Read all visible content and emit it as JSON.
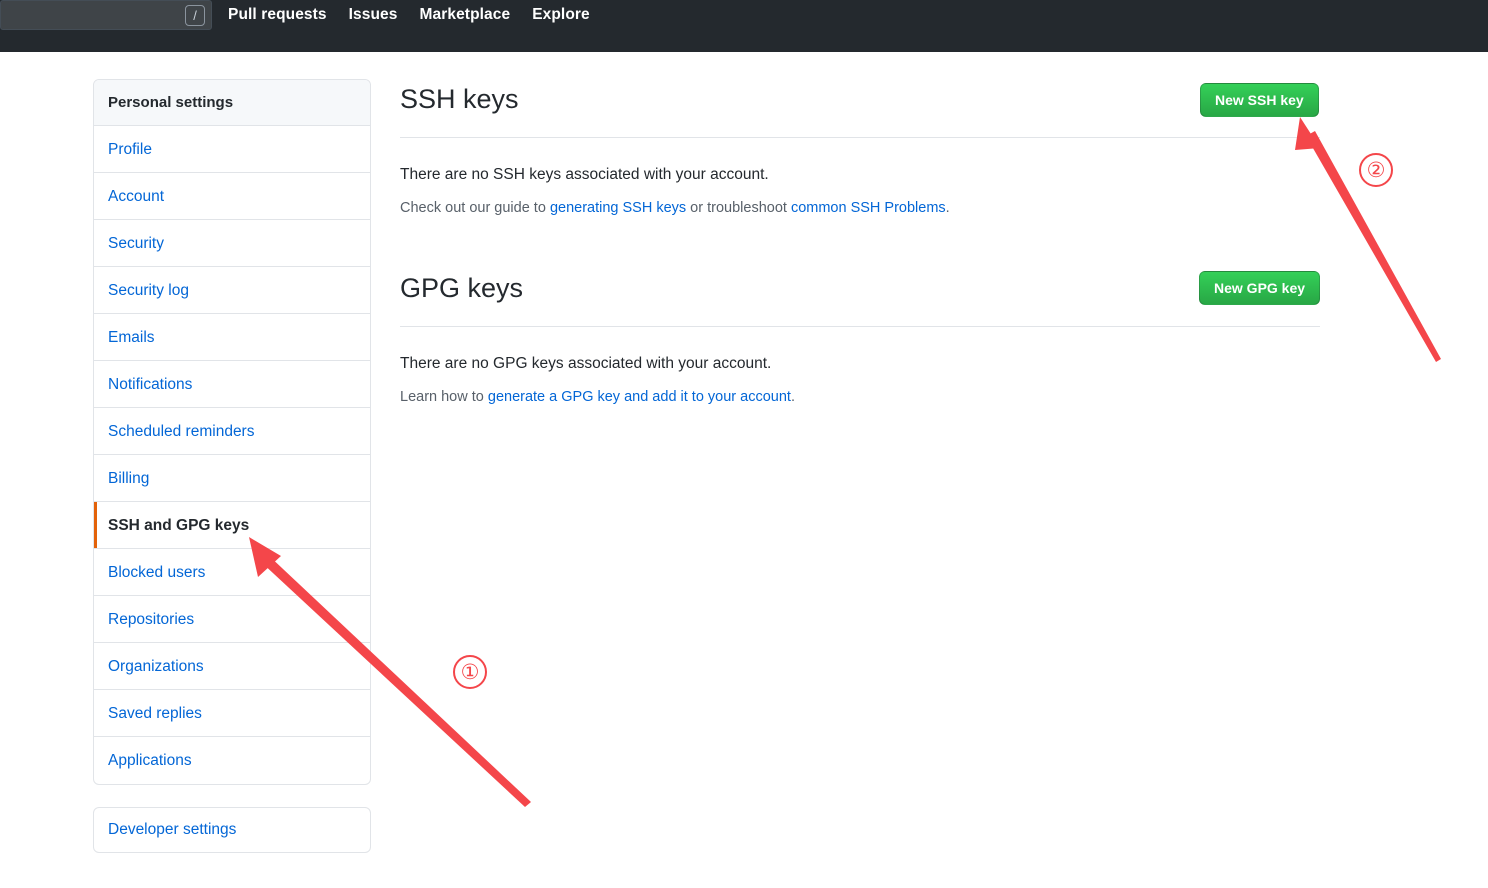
{
  "topbar": {
    "search": {
      "value": "",
      "placeholder": "",
      "shortcut": "/"
    },
    "nav_items": [
      {
        "label": "Pull requests"
      },
      {
        "label": "Issues"
      },
      {
        "label": "Marketplace"
      },
      {
        "label": "Explore"
      }
    ]
  },
  "sidebar": {
    "header": "Personal settings",
    "items": [
      {
        "label": "Profile",
        "selected": false
      },
      {
        "label": "Account",
        "selected": false
      },
      {
        "label": "Security",
        "selected": false
      },
      {
        "label": "Security log",
        "selected": false
      },
      {
        "label": "Emails",
        "selected": false
      },
      {
        "label": "Notifications",
        "selected": false
      },
      {
        "label": "Scheduled reminders",
        "selected": false
      },
      {
        "label": "Billing",
        "selected": false
      },
      {
        "label": "SSH and GPG keys",
        "selected": true
      },
      {
        "label": "Blocked users",
        "selected": false
      },
      {
        "label": "Repositories",
        "selected": false
      },
      {
        "label": "Organizations",
        "selected": false
      },
      {
        "label": "Saved replies",
        "selected": false
      },
      {
        "label": "Applications",
        "selected": false
      }
    ],
    "developer_settings": "Developer settings"
  },
  "main": {
    "ssh": {
      "title": "SSH keys",
      "button": "New SSH key",
      "empty_text": "There are no SSH keys associated with your account.",
      "help_prefix": "Check out our guide to ",
      "help_link1": "generating SSH keys",
      "help_middle": " or troubleshoot ",
      "help_link2": "common SSH Problems",
      "help_suffix": "."
    },
    "gpg": {
      "title": "GPG keys",
      "button": "New GPG key",
      "empty_text": "There are no GPG keys associated with your account.",
      "help_prefix": "Learn how to ",
      "help_link1": "generate a GPG key and add it to your account",
      "help_suffix": "."
    }
  },
  "annotations": {
    "color": "#f4464a",
    "markers": [
      {
        "label": "①",
        "target": "sidebar-item-ssh-and-gpg-keys"
      },
      {
        "label": "②",
        "target": "new-ssh-key-button"
      }
    ]
  },
  "colors": {
    "header_bg": "#24292e",
    "link": "#0366d6",
    "button_green": "#28a745",
    "selected_accent": "#e36209",
    "border": "#e1e4e8"
  }
}
